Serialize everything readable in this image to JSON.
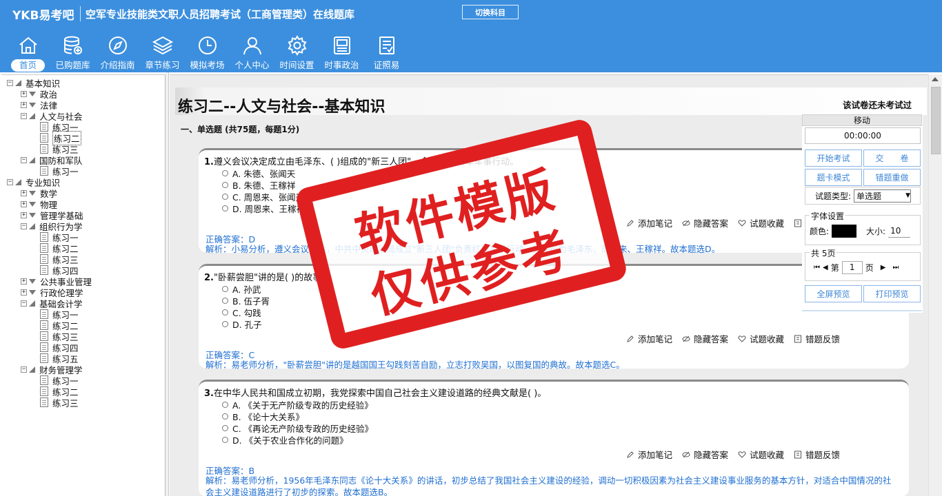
{
  "header": {
    "logo": "YKB易考吧",
    "title": "空军专业技能类文职人员招聘考试（工商管理类）在线题库",
    "switch_label": "切换科目"
  },
  "nav": [
    {
      "label": "首页",
      "icon": "home-icon",
      "active": true
    },
    {
      "label": "已购题库",
      "icon": "database-icon"
    },
    {
      "label": "介绍指南",
      "icon": "compass-icon"
    },
    {
      "label": "章节练习",
      "icon": "layers-icon"
    },
    {
      "label": "模拟考场",
      "icon": "clock-icon"
    },
    {
      "label": "个人中心",
      "icon": "user-icon"
    },
    {
      "label": "时间设置",
      "icon": "gear-icon"
    },
    {
      "label": "时事政治",
      "icon": "newspaper-icon"
    },
    {
      "label": "证照易",
      "icon": "certificate-icon"
    }
  ],
  "tree": [
    {
      "label": "基本知识",
      "level": 0,
      "expanded": true
    },
    {
      "label": "政治",
      "level": 1,
      "expanded": false
    },
    {
      "label": "法律",
      "level": 1,
      "expanded": false
    },
    {
      "label": "人文与社会",
      "level": 1,
      "expanded": true
    },
    {
      "label": "练习一",
      "level": 2
    },
    {
      "label": "练习二",
      "level": 2,
      "selected": true
    },
    {
      "label": "练习三",
      "level": 2
    },
    {
      "label": "国防和军队",
      "level": 1,
      "expanded": true
    },
    {
      "label": "练习一",
      "level": 2
    },
    {
      "label": "专业知识",
      "level": 0,
      "expanded": true
    },
    {
      "label": "数学",
      "level": 1,
      "expanded": false
    },
    {
      "label": "物理",
      "level": 1,
      "expanded": false
    },
    {
      "label": "管理学基础",
      "level": 1,
      "expanded": false
    },
    {
      "label": "组织行为学",
      "level": 1,
      "expanded": true
    },
    {
      "label": "练习一",
      "level": 2
    },
    {
      "label": "练习二",
      "level": 2
    },
    {
      "label": "练习三",
      "level": 2
    },
    {
      "label": "练习四",
      "level": 2
    },
    {
      "label": "公共事业管理",
      "level": 1,
      "expanded": false
    },
    {
      "label": "行政伦理学",
      "level": 1,
      "expanded": false
    },
    {
      "label": "基础会计学",
      "level": 1,
      "expanded": true
    },
    {
      "label": "练习一",
      "level": 2
    },
    {
      "label": "练习二",
      "level": 2
    },
    {
      "label": "练习三",
      "level": 2
    },
    {
      "label": "练习四",
      "level": 2
    },
    {
      "label": "练习五",
      "level": 2
    },
    {
      "label": "财务管理学",
      "level": 1,
      "expanded": true
    },
    {
      "label": "练习一",
      "level": 2
    },
    {
      "label": "练习二",
      "level": 2
    },
    {
      "label": "练习三",
      "level": 2
    }
  ],
  "paper": {
    "title": "练习二--人文与社会--基本知识",
    "status": "该试卷还未考试过",
    "section": "一、单选题 (共75题，每题1分)"
  },
  "actions": {
    "note": "添加笔记",
    "hide": "隐藏答案",
    "fav": "试题收藏",
    "report": "错题反馈"
  },
  "questions": [
    {
      "num": "1.",
      "text": "遵义会议决定成立由毛泽东、( )组成的\"新三人团\"，全权负责红军军事行动。",
      "options": [
        "A. 朱德、张闻天",
        "B. 朱德、王稼祥",
        "C. 周恩来、张闻天",
        "D. 周恩来、王稼祥"
      ],
      "answer": "正确答案：D",
      "analysis": "解析：小易分析，遵义会议以后，中共中央政治局成立\"新三人团\"负责红军军事行动，其成员为毛泽东、周恩来、王稼祥。故本题选D。"
    },
    {
      "num": "2.",
      "text": "\"卧薪尝胆\"讲的是( )的故事。",
      "options": [
        "A. 孙武",
        "B. 伍子胥",
        "C. 勾践",
        "D. 孔子"
      ],
      "answer": "正确答案：C",
      "analysis": "解析：易老师分析，\"卧薪尝胆\"讲的是越国国王勾践刻苦自励，立志打败吴国，以图复国的典故。故本题选C。"
    },
    {
      "num": "3.",
      "text": "在中华人民共和国成立初期，我党探索中国自己社会主义建设道路的经典文献是( )。",
      "options": [
        "A. 《关于无产阶级专政的历史经验》",
        "B. 《论十大关系》",
        "C. 《再论无产阶级专政的历史经验》",
        "D. 《关于农业合作化的问题》"
      ],
      "answer": "正确答案：B",
      "analysis": "解析：易老师分析，1956年毛泽东同志《论十大关系》的讲话，初步总结了我国社会主义建设的经验，调动一切积极因素为社会主义建设事业服务的基本方针，对适合中国情况的社会主义建设道路进行了初步的探索。故本题选B。"
    }
  ],
  "control": {
    "move": "移动",
    "timer": "00:00:00",
    "start": "开始考试",
    "submit": "交　　卷",
    "card_mode": "题卡模式",
    "redo_wrong": "错题重做",
    "type_label": "试题类型:",
    "type_value": "单选题",
    "font_legend": "字体设置",
    "color_label": "颜色:",
    "size_label": "大小:",
    "size_value": "10",
    "page_legend": "共 5页",
    "page_prefix": "第",
    "page_value": "1",
    "page_suffix": "页",
    "fullscreen": "全屏预览",
    "print": "打印预览"
  },
  "stamp": {
    "line1": "软件模版",
    "line2": "仅供参考"
  },
  "colors": {
    "header_bg": "#3c8fde",
    "link": "#1f6fd1",
    "stamp": "#e02020"
  }
}
